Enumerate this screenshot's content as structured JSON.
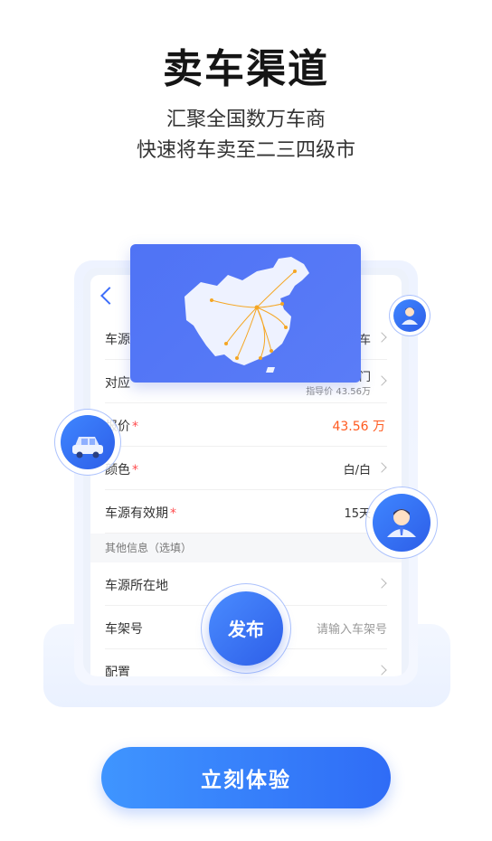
{
  "header": {
    "title": "卖车渠道",
    "subtitle_line1": "汇聚全国数万车商",
    "subtitle_line2": "快速将车卖至二三四级市"
  },
  "form": {
    "rows": [
      {
        "label": "车源",
        "value": "车"
      },
      {
        "label": "对应",
        "value": "门",
        "sub_value": "指导价 43.56万"
      },
      {
        "label": "报价",
        "required": "*",
        "value": "43.56 万"
      },
      {
        "label": "颜色",
        "required": "*",
        "value": "白/白"
      },
      {
        "label": "车源有效期",
        "required": "*",
        "value": "15天"
      }
    ],
    "section_title": "其他信息（选填）",
    "extra_rows": [
      {
        "label": "车源所在地",
        "value": ""
      },
      {
        "label": "车架号",
        "placeholder": "请输入车架号"
      },
      {
        "label": "配置",
        "value": ""
      }
    ]
  },
  "publish_button": "发布",
  "cta_button": "立刻体验",
  "icons": [
    "back-arrow-icon",
    "china-map-icon",
    "car-icon",
    "user-icon",
    "chevron-right-icon"
  ],
  "colors": {
    "accent": "#2f6cf6",
    "price": "#ff5a1f",
    "map_bg": "#5577f6",
    "route": "#f5a623"
  }
}
